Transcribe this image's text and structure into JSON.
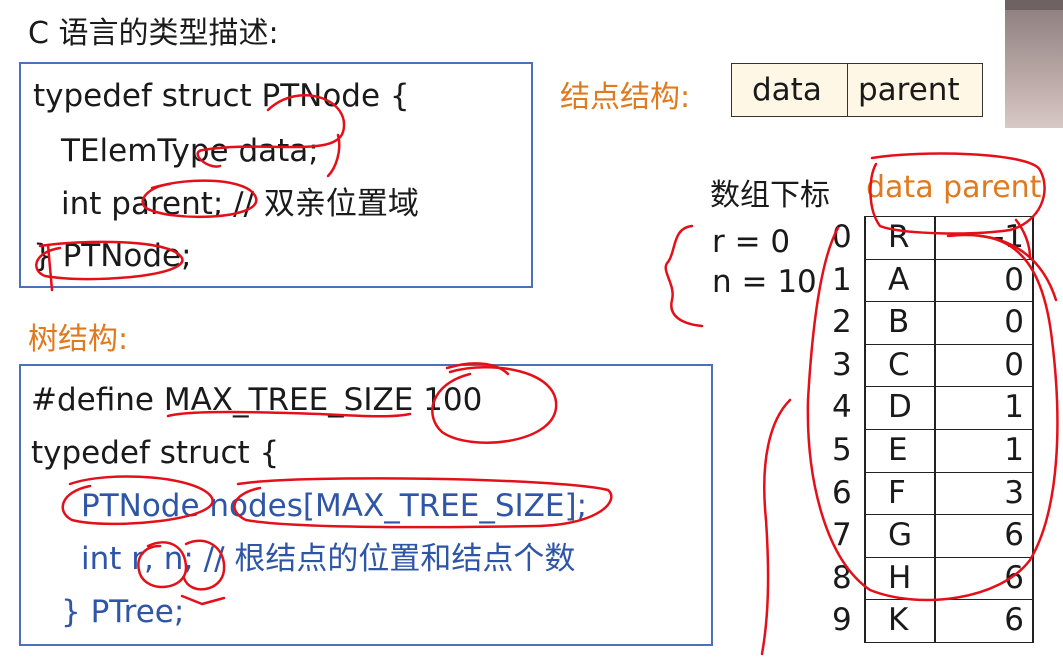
{
  "title": "C 语言的类型描述:",
  "node_struct": {
    "code": [
      "typedef struct PTNode {",
      "TElemType  data;",
      "int    parent;   // 双亲位置域",
      "} PTNode;"
    ]
  },
  "node_structure": {
    "label": "结点结构:",
    "fields": [
      "data",
      "parent"
    ]
  },
  "tree_struct": {
    "label": "树结构:",
    "code": [
      "#define MAX_TREE_SIZE  100",
      "typedef struct {",
      "PTNode  nodes[MAX_TREE_SIZE];",
      "int    r, n;     // 根结点的位置和结点个数",
      "} PTree;"
    ]
  },
  "array_table": {
    "index_header": "数组下标",
    "column_header": "data parent",
    "r_label": "r = 0",
    "n_label": "n = 10",
    "rows": [
      {
        "index": "0",
        "data": "R",
        "parent": "-1"
      },
      {
        "index": "1",
        "data": "A",
        "parent": "0"
      },
      {
        "index": "2",
        "data": "B",
        "parent": "0"
      },
      {
        "index": "3",
        "data": "C",
        "parent": "0"
      },
      {
        "index": "4",
        "data": "D",
        "parent": "1"
      },
      {
        "index": "5",
        "data": "E",
        "parent": "1"
      },
      {
        "index": "6",
        "data": "F",
        "parent": "3"
      },
      {
        "index": "7",
        "data": "G",
        "parent": "6"
      },
      {
        "index": "8",
        "data": "H",
        "parent": "6"
      },
      {
        "index": "9",
        "data": "K",
        "parent": "6"
      }
    ]
  },
  "colors": {
    "accent_orange": "#e07a1f",
    "code_blue": "#2f56a6",
    "border_blue": "#4a72b8",
    "annotation_red": "#e3101a"
  }
}
